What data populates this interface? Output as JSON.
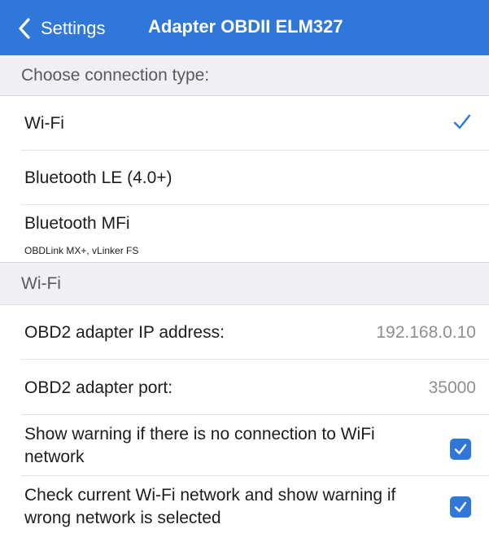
{
  "navbar": {
    "back_label": "Settings",
    "title": "Adapter OBDII ELM327",
    "back_icon": "chevron-left-icon"
  },
  "connection_section": {
    "header": "Choose connection type:",
    "options": [
      {
        "label": "Wi-Fi",
        "subtitle": "",
        "selected": true
      },
      {
        "label": "Bluetooth LE (4.0+)",
        "subtitle": "",
        "selected": false
      },
      {
        "label": "Bluetooth MFi",
        "subtitle": "OBDLink MX+, vLinker FS",
        "selected": false
      }
    ]
  },
  "wifi_section": {
    "header": "Wi-Fi",
    "ip": {
      "label": "OBD2 adapter IP address:",
      "value": "192.168.0.10"
    },
    "port": {
      "label": "OBD2 adapter port:",
      "value": "35000"
    },
    "warn_no_connection": {
      "label": "Show warning if there is no connection to WiFi network",
      "checked": true
    },
    "warn_wrong_network": {
      "label": "Check current Wi-Fi network and show warning if wrong network is selected",
      "checked": true
    }
  },
  "colors": {
    "accent": "#2f77d8",
    "section_bg": "#efeff4",
    "value_gray": "#8e8e93"
  }
}
